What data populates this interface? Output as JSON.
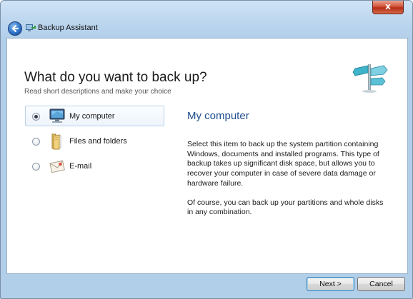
{
  "window": {
    "title": "Backup Assistant",
    "close_label": "x",
    "icons": {
      "back": "back-arrow-icon",
      "app": "backup-assistant-icon",
      "hero": "signpost-icon"
    }
  },
  "header": {
    "title": "What do you want to back up?",
    "subtitle": "Read short descriptions and make your choice"
  },
  "options": [
    {
      "label": "My computer",
      "icon": "computer-icon",
      "selected": true
    },
    {
      "label": "Files and folders",
      "icon": "folder-icon",
      "selected": false
    },
    {
      "label": "E-mail",
      "icon": "email-icon",
      "selected": false
    }
  ],
  "detail": {
    "title": "My computer",
    "paragraph1": "Select this item to back up the system partition containing Windows, documents and installed programs. This type of backup takes up significant disk space, but allows you to recover your computer in case of severe data damage or hardware failure.",
    "paragraph2": "Of course, you can back up your partitions and whole disks in any combination."
  },
  "footer": {
    "next_label": "Next >",
    "cancel_label": "Cancel"
  },
  "colors": {
    "title_blue": "#1f4e8c",
    "chrome": "#bcd6ee",
    "close_red": "#c8391f"
  }
}
